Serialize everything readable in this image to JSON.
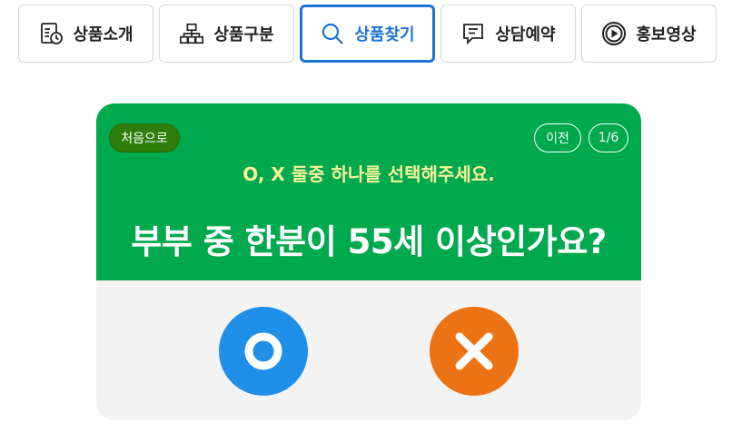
{
  "tabs": [
    {
      "label": "상품소개",
      "icon": "document-clock-icon",
      "active": false
    },
    {
      "label": "상품구분",
      "icon": "org-chart-icon",
      "active": false
    },
    {
      "label": "상품찾기",
      "icon": "search-icon",
      "active": true
    },
    {
      "label": "상담예약",
      "icon": "chat-bubble-icon",
      "active": false
    },
    {
      "label": "홍보영상",
      "icon": "play-icon",
      "active": false
    }
  ],
  "quiz": {
    "home_label": "처음으로",
    "prev_label": "이전",
    "step": "1/6",
    "instruction": "O, X 둘중 하나를 선택해주세요.",
    "question": "부부 중 한분이 55세 이상인가요?",
    "answer_yes_icon": "circle-o-icon",
    "answer_no_icon": "x-icon"
  },
  "colors": {
    "accent": "#1a73d6",
    "card_green": "#00a84e",
    "home_button": "#2e7d0a",
    "instruction_text": "#f7f59a",
    "yes": "#1f8fe8",
    "no": "#ec7214"
  }
}
